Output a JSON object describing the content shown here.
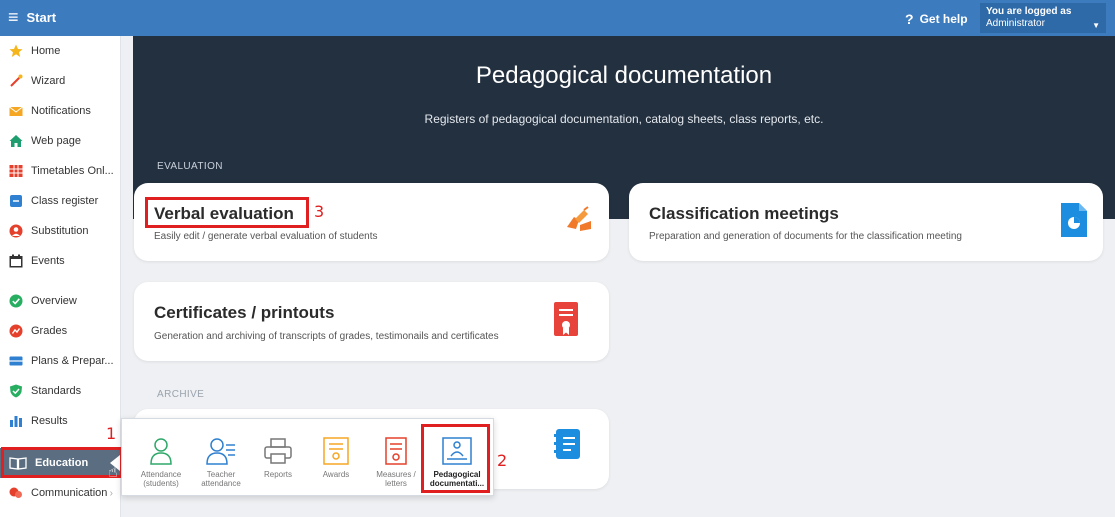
{
  "topbar": {
    "menu_label": "Start",
    "help_label": "Get help",
    "user_line1": "You are logged as",
    "user_line2": "Administrator"
  },
  "sidebar": {
    "items": [
      {
        "label": "Home",
        "icon": "star-icon"
      },
      {
        "label": "Wizard",
        "icon": "wizard-icon"
      },
      {
        "label": "Notifications",
        "icon": "envelope-icon"
      },
      {
        "label": "Web page",
        "icon": "house-icon"
      },
      {
        "label": "Timetables Onl...",
        "icon": "timetable-icon"
      },
      {
        "label": "Class register",
        "icon": "register-icon"
      },
      {
        "label": "Substitution",
        "icon": "person-icon"
      },
      {
        "label": "Events",
        "icon": "calendar-icon"
      },
      {
        "label": "Overview",
        "icon": "check-icon"
      },
      {
        "label": "Grades",
        "icon": "grades-icon"
      },
      {
        "label": "Plans & Prepar...",
        "icon": "plans-icon"
      },
      {
        "label": "Standards",
        "icon": "shield-check-icon"
      },
      {
        "label": "Results",
        "icon": "bar-chart-icon"
      },
      {
        "label": "Education",
        "icon": "book-icon"
      },
      {
        "label": "Communication",
        "icon": "chat-icon"
      }
    ]
  },
  "header": {
    "title": "Pedagogical documentation",
    "subtitle": "Registers of pedagogical documentation, catalog sheets, class reports, etc."
  },
  "sections": {
    "evaluation": "EVALUATION",
    "archive": "ARCHIVE"
  },
  "cards": {
    "verbal": {
      "title": "Verbal evaluation",
      "desc": "Easily edit / generate verbal evaluation of students"
    },
    "classification": {
      "title": "Classification meetings",
      "desc": "Preparation and generation of documents for the classification meeting"
    },
    "certificates": {
      "title": "Certificates / printouts",
      "desc": "Generation and archiving of transcripts of grades, testimonails and certificates"
    }
  },
  "popup": {
    "items": [
      {
        "line1": "Attendance",
        "line2": "(students)"
      },
      {
        "line1": "Teacher",
        "line2": "attendance"
      },
      {
        "line1": "Reports",
        "line2": ""
      },
      {
        "line1": "Awards",
        "line2": ""
      },
      {
        "line1": "Measures /",
        "line2": "letters"
      },
      {
        "line1": "Pedagogical",
        "line2": "documentati..."
      }
    ]
  },
  "annotations": {
    "one": "1",
    "two": "2",
    "three": "3"
  },
  "colors": {
    "topbar": "#3d7bbf",
    "header": "#23303f",
    "highlight": "#e02020",
    "active_item": "#5b6d80"
  }
}
